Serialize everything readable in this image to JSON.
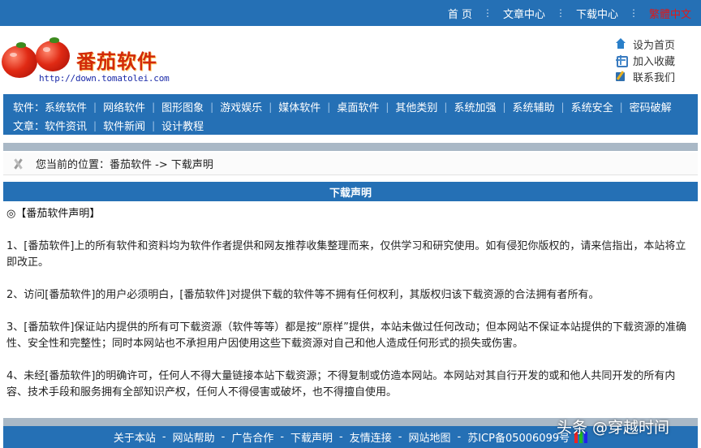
{
  "top_nav": {
    "items": [
      "首 页",
      "文章中心",
      "下载中心",
      "繁體中文"
    ],
    "alt_color": "#e01818"
  },
  "logo": {
    "name": "番茄软件",
    "url": "http://down.tomatolei.com"
  },
  "quick_links": [
    {
      "icon": "home-icon",
      "label": "设为首页"
    },
    {
      "icon": "favorite-icon",
      "label": "加入收藏"
    },
    {
      "icon": "contact-icon",
      "label": "联系我们"
    }
  ],
  "category_nav": {
    "software_label": "软件：",
    "software_items": [
      "系统软件",
      "网络软件",
      "图形图象",
      "游戏娱乐",
      "媒体软件",
      "桌面软件",
      "其他类别",
      "系统加强",
      "系统辅助",
      "系统安全",
      "密码破解"
    ],
    "article_label": "文章：",
    "article_items": [
      "软件资讯",
      "软件新闻",
      "设计教程"
    ]
  },
  "breadcrumb": {
    "text": "您当前的位置：番茄软件 -> 下载声明"
  },
  "section_title": "下载声明",
  "statement": {
    "heading": "◎【番茄软件声明】",
    "paragraphs": [
      "1、[番茄软件]上的所有软件和资料均为软件作者提供和网友推荐收集整理而来，仅供学习和研究使用。如有侵犯你版权的，请来信指出，本站将立即改正。",
      "2、访问[番茄软件]的用户必须明白，[番茄软件]对提供下载的软件等不拥有任何权利，其版权归该下载资源的合法拥有者所有。",
      "3、[番茄软件]保证站内提供的所有可下载资源（软件等等）都是按“原样”提供，本站未做过任何改动；但本网站不保证本站提供的下载资源的准确性、安全性和完整性；同时本网站也不承担用户因使用这些下载资源对自己和他人造成任何形式的损失或伤害。",
      "4、未经[番茄软件]的明确许可，任何人不得大量链接本站下载资源；不得复制或仿造本网站。本网站对其自行开发的或和他人共同开发的所有内容、技术手段和服务拥有全部知识产权，任何人不得侵害或破坏，也不得擅自使用。"
    ]
  },
  "footer": {
    "links": [
      "关于本站",
      "网站帮助",
      "广告合作",
      "下载声明",
      "友情连接",
      "网站地图"
    ],
    "icp": "苏ICP备05006099号"
  },
  "watermark": "头条 @穿越时间",
  "colors": {
    "primary": "#2570b5",
    "divider": "#a9b8c6"
  }
}
